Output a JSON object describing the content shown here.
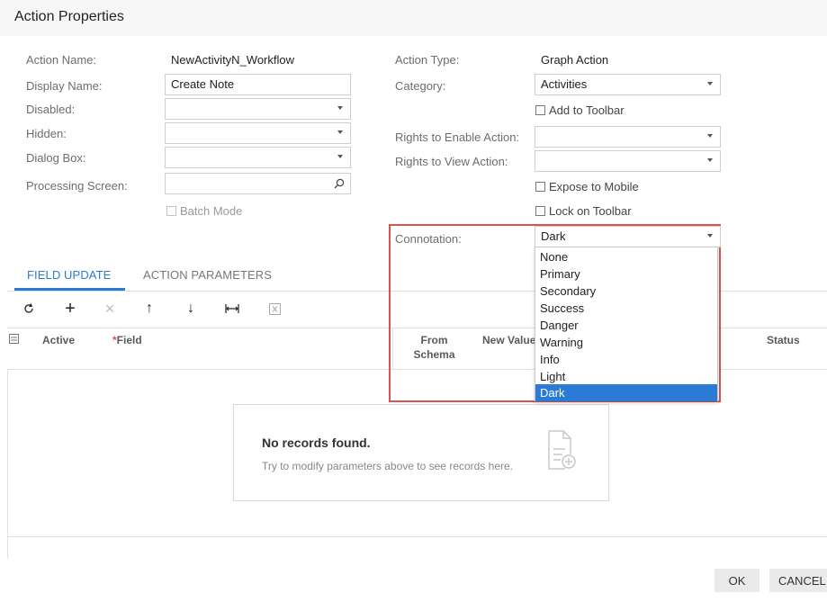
{
  "dialog": {
    "title": "Action Properties"
  },
  "left_fields": {
    "action_name_label": "Action Name:",
    "action_name_value": "NewActivityN_Workflow",
    "display_name_label": "Display Name:",
    "display_name_value": "Create Note",
    "disabled_label": "Disabled:",
    "hidden_label": "Hidden:",
    "dialog_box_label": "Dialog Box:",
    "processing_screen_label": "Processing Screen:",
    "batch_mode_label": "Batch Mode"
  },
  "right_fields": {
    "action_type_label": "Action Type:",
    "action_type_value": "Graph Action",
    "category_label": "Category:",
    "category_value": "Activities",
    "add_to_toolbar_label": "Add to Toolbar",
    "rights_enable_label": "Rights to Enable Action:",
    "rights_view_label": "Rights to View Action:",
    "expose_mobile_label": "Expose to Mobile",
    "lock_toolbar_label": "Lock on Toolbar",
    "connotation_label": "Connotation:",
    "connotation_value": "Dark"
  },
  "connotation_options": [
    "None",
    "Primary",
    "Secondary",
    "Success",
    "Danger",
    "Warning",
    "Info",
    "Light",
    "Dark"
  ],
  "tabs": [
    {
      "label": "FIELD UPDATE",
      "active": true
    },
    {
      "label": "ACTION PARAMETERS",
      "active": false
    }
  ],
  "toolbar_icons": [
    "refresh-icon",
    "add-icon",
    "delete-icon",
    "move-up-icon",
    "move-down-icon",
    "fit-columns-icon",
    "export-excel-icon"
  ],
  "grid": {
    "columns": [
      "Active",
      "Field",
      "From Schema",
      "New Value",
      "Status"
    ],
    "from_schema_line1": "From",
    "from_schema_line2": "Schema",
    "required_mark": "*"
  },
  "empty_state": {
    "title": "No records found.",
    "message": "Try to modify parameters above to see records here."
  },
  "footer": {
    "ok_label": "OK",
    "cancel_label": "CANCEL"
  },
  "colors": {
    "accent": "#2b7ad6",
    "highlight_border": "#d9534f",
    "required": "#d9534f"
  }
}
